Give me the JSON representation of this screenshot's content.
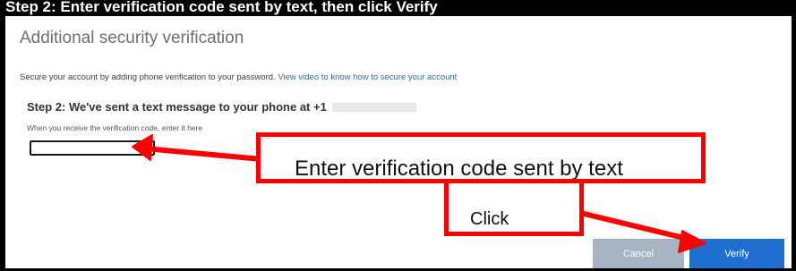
{
  "top_banner": {
    "text": "Step 2: Enter verification code sent by text, then click Verify"
  },
  "title": "Additional security verification",
  "intro": {
    "text": "Secure your account by adding phone verification to your password.",
    "link_text": "View video to know how to secure your account"
  },
  "step": {
    "text": "Step 2: We've sent a text message to your phone at +1"
  },
  "hint": "When you receive the verification code, enter it here",
  "code_input": {
    "value": ""
  },
  "annotations": {
    "enter_code": "Enter verification code sent by text",
    "click": "Click"
  },
  "buttons": {
    "cancel": "Cancel",
    "verify": "Verify"
  },
  "colors": {
    "annotation_red": "#ff0000",
    "verify_blue": "#1f6fd1",
    "cancel_gray": "#a6b4c4",
    "link_blue": "#2b6cb0"
  }
}
